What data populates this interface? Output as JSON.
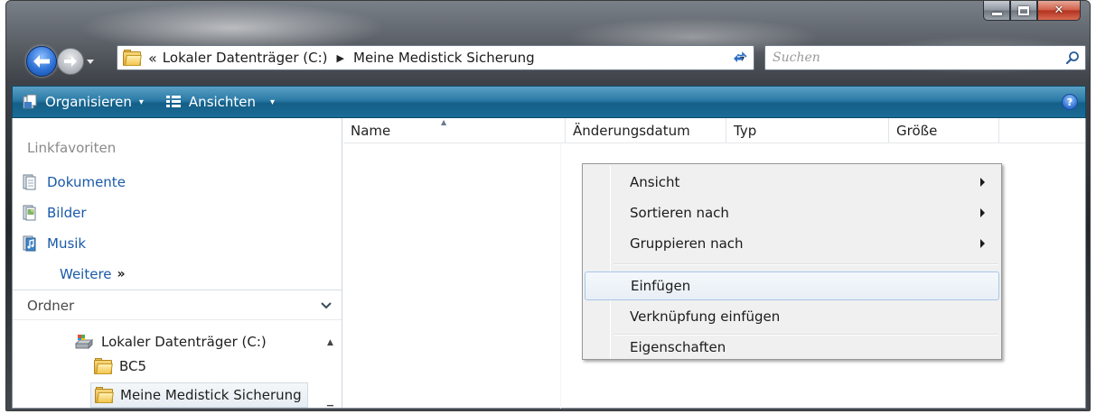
{
  "window": {
    "colors": {
      "toolbar": "#1b6c96",
      "link": "#1a5aa8",
      "close": "#c9452d"
    }
  },
  "address_bar": {
    "overflow_chevron": "«",
    "crumbs": [
      "Lokaler Datenträger (C:)",
      "Meine Medistick Sicherung"
    ],
    "separator": "▶",
    "dropdown": "▾"
  },
  "search": {
    "placeholder": "Suchen"
  },
  "toolbar": {
    "organize_label": "Organisieren",
    "views_label": "Ansichten",
    "caret": "▾",
    "help": "?"
  },
  "nav_pane": {
    "favorites_heading": "Linkfavoriten",
    "links": [
      {
        "label": "Dokumente",
        "icon": "documents-icon"
      },
      {
        "label": "Bilder",
        "icon": "pictures-icon"
      },
      {
        "label": "Musik",
        "icon": "music-icon"
      }
    ],
    "more_label": "Weitere",
    "more_chevron": "»",
    "folders_heading": "Ordner",
    "folders_chevron": "⌄",
    "tree": [
      {
        "label": "Lokaler Datenträger (C:)",
        "icon": "drive-icon"
      },
      {
        "label": "BC5",
        "icon": "folder-icon"
      },
      {
        "label": "Meine Medistick Sicherung",
        "icon": "folder-icon",
        "selected": true
      }
    ]
  },
  "file_list": {
    "columns": [
      "Name",
      "Änderungsdatum",
      "Typ",
      "Größe"
    ],
    "sort_indicator": "▲"
  },
  "context_menu": {
    "items": [
      {
        "label": "Ansicht",
        "submenu": true
      },
      {
        "label": "Sortieren nach",
        "submenu": true
      },
      {
        "label": "Gruppieren nach",
        "submenu": true
      },
      {
        "label": "Einfügen",
        "highlighted": true
      },
      {
        "label": "Verknüpfung einfügen"
      },
      {
        "label": "Eigenschaften"
      }
    ]
  }
}
